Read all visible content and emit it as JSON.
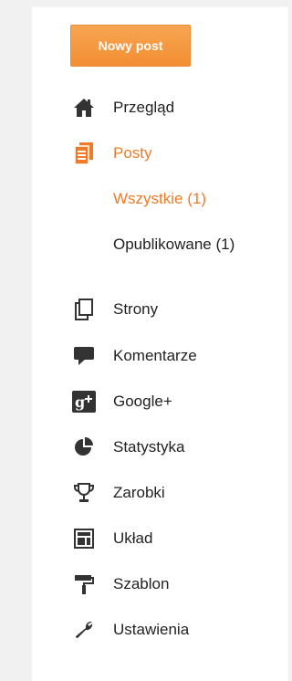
{
  "new_post_label": "Nowy post",
  "nav": {
    "overview": "Przegląd",
    "posts": "Posty",
    "posts_all": "Wszystkie (1)",
    "posts_published": "Opublikowane (1)",
    "pages": "Strony",
    "comments": "Komentarze",
    "google_plus": "Google+",
    "stats": "Statystyka",
    "earnings": "Zarobki",
    "layout": "Układ",
    "template": "Szablon",
    "settings": "Ustawienia"
  },
  "colors": {
    "accent": "#f07b26",
    "button": "#f38e32",
    "icon": "#333333",
    "text": "#222222"
  }
}
